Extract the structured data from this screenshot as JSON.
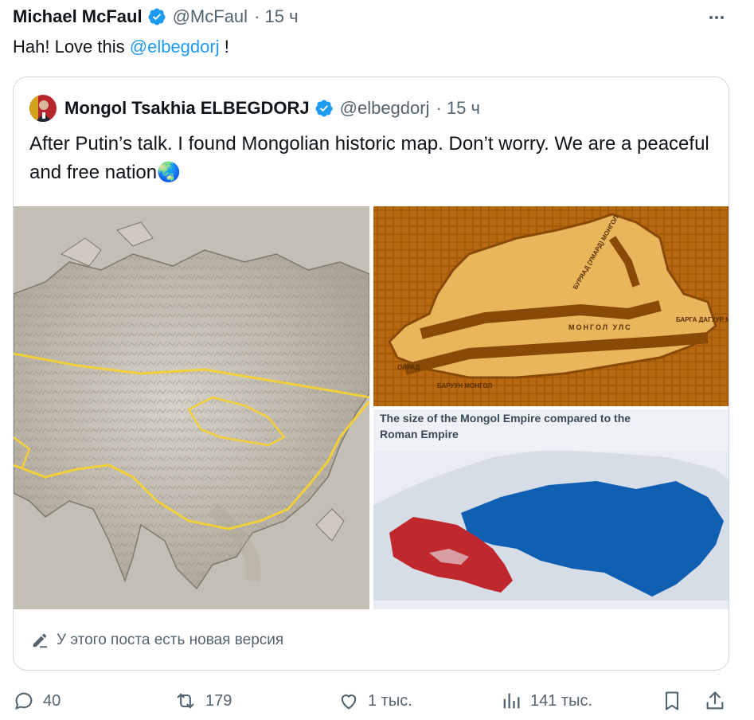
{
  "tweet": {
    "author_name": "Michael McFaul",
    "author_handle": "@McFaul",
    "time": "· 15 ч",
    "text_before": "Hah! Love this ",
    "mention": "@elbegdorj",
    "text_after": " !"
  },
  "quote": {
    "author_name": "Mongol Tsakhia ELBEGDORJ",
    "author_handle": "@elbegdorj",
    "time": "· 15 ч",
    "text": "After Putin’s talk. I found Mongolian historic map. Don’t worry. We are a peaceful and free nation",
    "emoji": "🌏",
    "map2_labels": [
      "МОНГОЛ УЛС",
      "БУРЯАД (УМАРД) МОНГОЛ",
      "БАРГА ДАГУУР МОНГОЛ",
      "ОЙРАД",
      "БАРУУН МОНГОЛ"
    ],
    "map3_title": "The size of the Mongol Empire compared to the Roman Empire",
    "new_version_notice": "У этого поста есть новая версия"
  },
  "actions": {
    "replies": "40",
    "reposts": "179",
    "likes": "1 тыс.",
    "views": "141 тыс."
  },
  "colors": {
    "accent": "#1d9bf0",
    "text": "#0f1419",
    "muted": "#536471",
    "border": "#cfd9de",
    "roman_red": "#c0282d",
    "mongol_blue": "#0f5fb3"
  }
}
